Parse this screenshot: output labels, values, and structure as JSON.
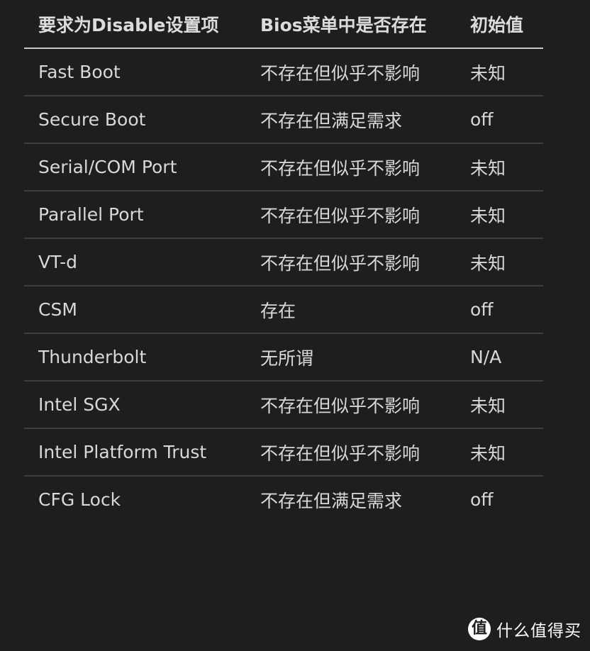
{
  "table": {
    "headers": [
      "要求为Disable设置项",
      "Bios菜单中是否存在",
      "初始值"
    ],
    "rows": [
      [
        "Fast Boot",
        "不存在但似乎不影响",
        "未知"
      ],
      [
        "Secure Boot",
        "不存在但满足需求",
        "off"
      ],
      [
        "Serial/COM Port",
        "不存在但似乎不影响",
        "未知"
      ],
      [
        "Parallel Port",
        "不存在但似乎不影响",
        "未知"
      ],
      [
        "VT-d",
        "不存在但似乎不影响",
        "未知"
      ],
      [
        "CSM",
        "存在",
        "off"
      ],
      [
        "Thunderbolt",
        "无所谓",
        "N/A"
      ],
      [
        "Intel SGX",
        "不存在但似乎不影响",
        "未知"
      ],
      [
        "Intel Platform Trust",
        "不存在但似乎不影响",
        "未知"
      ],
      [
        "CFG Lock",
        "不存在但满足需求",
        "off"
      ]
    ]
  },
  "watermark": {
    "logo_glyph": "值",
    "text": "什么值得买"
  }
}
